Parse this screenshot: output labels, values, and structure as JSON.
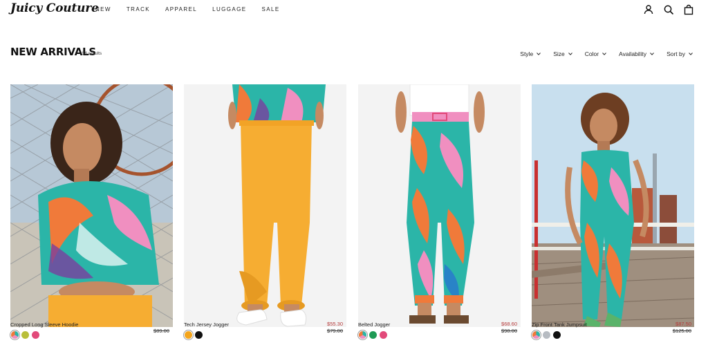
{
  "header": {
    "logo": "Juicy Couture",
    "nav": [
      "NEW",
      "TRACK",
      "APPAREL",
      "LUGGAGE",
      "SALE"
    ],
    "icons": [
      "account-icon",
      "search-icon",
      "cart-icon"
    ]
  },
  "collection": {
    "title": "NEW ARRIVALS",
    "results": "56 results",
    "filters": [
      "Style",
      "Size",
      "Color",
      "Availability",
      "Sort by"
    ]
  },
  "products": [
    {
      "name": "Cropped Long Sleeve Hoodie",
      "sale_price": "",
      "original_price": "$89.00",
      "swatches": [
        "#a9c7c3",
        "#b9bf3a",
        "#e24a7a"
      ]
    },
    {
      "name": "Tech Jersey Jogger",
      "sale_price": "$55.30",
      "original_price": "$79.00",
      "swatches": [
        "#f4a51c",
        "#111111"
      ]
    },
    {
      "name": "Belted Jogger",
      "sale_price": "$68.60",
      "original_price": "$98.00",
      "swatches": [
        "#a9c7c3",
        "#1f9a55",
        "#e24a7a"
      ]
    },
    {
      "name": "Zip Front Tank Jumpsuit",
      "sale_price": "$87.50",
      "original_price": "$125.00",
      "swatches": [
        "#a9c7c3",
        "#b7bcc2",
        "#111111"
      ]
    }
  ],
  "colors": {
    "sale": "#b53a3a",
    "print_orange": "#f07a3a",
    "print_teal": "#2bb5a8",
    "print_pink": "#f08fc0",
    "jogger_yellow": "#f6ad32"
  }
}
